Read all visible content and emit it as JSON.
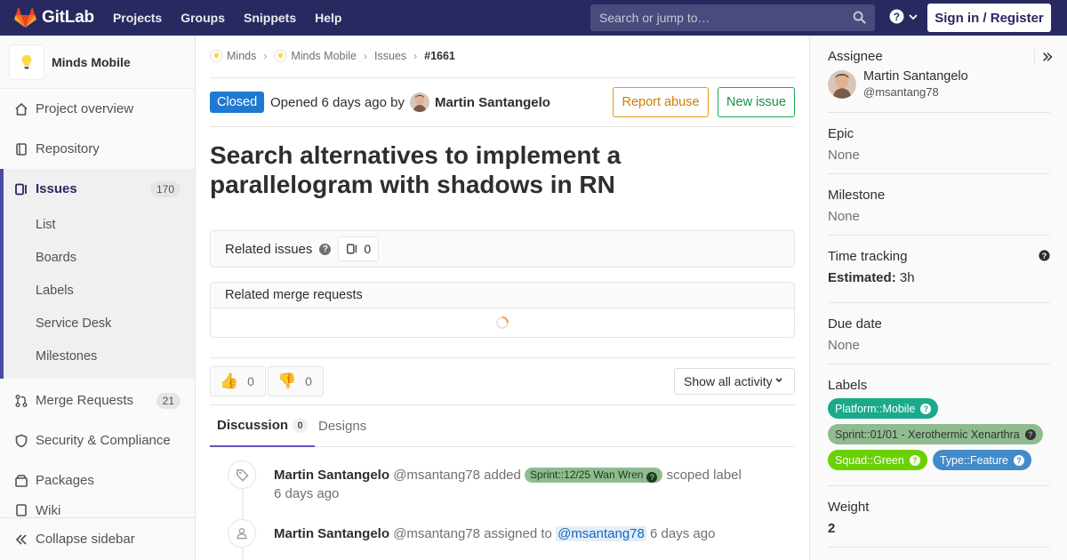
{
  "navbar": {
    "brand": "GitLab",
    "links": [
      "Projects",
      "Groups",
      "Snippets",
      "Help"
    ],
    "search_placeholder": "Search or jump to…",
    "signin_label": "Sign in / Register"
  },
  "sidebar": {
    "project_name": "Minds Mobile",
    "items": [
      {
        "label": "Project overview",
        "icon": "home-icon"
      },
      {
        "label": "Repository",
        "icon": "book-icon"
      },
      {
        "label": "Issues",
        "icon": "issues-icon",
        "count": "170"
      },
      {
        "label": "Merge Requests",
        "icon": "merge-request-icon",
        "count": "21"
      },
      {
        "label": "Security & Compliance",
        "icon": "shield-icon"
      },
      {
        "label": "Packages",
        "icon": "package-icon"
      }
    ],
    "sub_items": [
      "List",
      "Boards",
      "Labels",
      "Service Desk",
      "Milestones"
    ],
    "partial_item": "Wiki",
    "collapse_label": "Collapse sidebar"
  },
  "breadcrumbs": {
    "group": "Minds",
    "project": "Minds Mobile",
    "section": "Issues",
    "current": "#1661"
  },
  "issue": {
    "status": "Closed",
    "opened_text": "Opened 6 days ago by",
    "author": "Martin Santangelo",
    "report_abuse_label": "Report abuse",
    "new_issue_label": "New issue",
    "title": "Search alternatives to implement a parallelogram with shadows in RN",
    "related_issues_label": "Related issues",
    "related_issues_count": "0",
    "related_mr_label": "Related merge requests",
    "thumbs_up_count": "0",
    "thumbs_down_count": "0",
    "activity_filter": "Show all activity",
    "tabs": [
      {
        "label": "Discussion",
        "count": "0"
      },
      {
        "label": "Designs"
      }
    ]
  },
  "notes": [
    {
      "author": "Martin Santangelo",
      "handle": "@msantang78",
      "action": "added",
      "scoped_label": "Sprint::12/25 Wan Wren",
      "suffix": "scoped label",
      "time": "6 days ago",
      "icon": "tag-icon"
    },
    {
      "author": "Martin Santangelo",
      "handle": "@msantang78",
      "action": "assigned to",
      "mention": "@msantang78",
      "time": "6 days ago",
      "icon": "user-icon"
    }
  ],
  "right_sidebar": {
    "assignee_title": "Assignee",
    "assignee_name": "Martin Santangelo",
    "assignee_handle": "@msantang78",
    "epic_title": "Epic",
    "epic_value": "None",
    "milestone_title": "Milestone",
    "milestone_value": "None",
    "time_tracking_title": "Time tracking",
    "estimated_label": "Estimated:",
    "estimated_value": "3h",
    "due_date_title": "Due date",
    "due_date_value": "None",
    "labels_title": "Labels",
    "labels": [
      {
        "text": "Platform::Mobile",
        "bg": "#1aaa8a",
        "fg": "#ffffff"
      },
      {
        "text": "Sprint::01/01 - Xerothermic Xenarthra",
        "bg": "#8fbc8f",
        "fg": "#333333"
      },
      {
        "text": "Squad::Green",
        "bg": "#69d100",
        "fg": "#ffffff"
      },
      {
        "text": "Type::Feature",
        "bg": "#428bca",
        "fg": "#ffffff"
      }
    ],
    "weight_title": "Weight",
    "weight_value": "2"
  },
  "colors": {
    "navbar": "#292961",
    "closed_badge": "#1f78d1",
    "report_abuse": "#e39a1a",
    "new_issue": "#1aaa55",
    "active_tab": "#6b4fbb"
  }
}
